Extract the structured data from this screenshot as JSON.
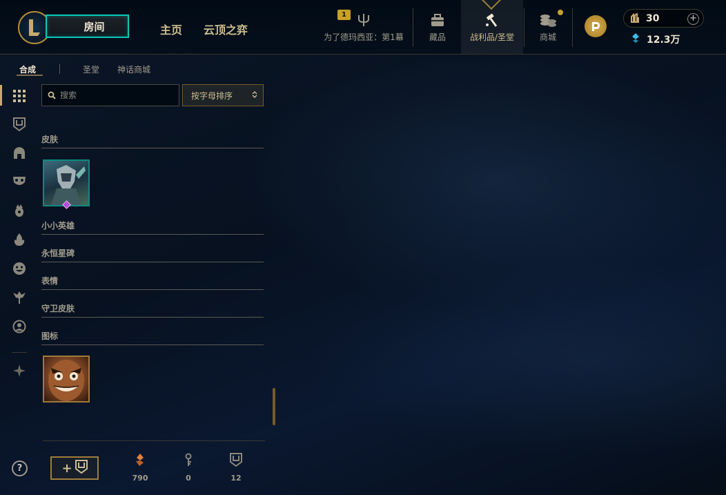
{
  "header": {
    "play_button": "房间",
    "nav_home": "主页",
    "nav_tft": "云顶之弈",
    "mission_badge": "1",
    "mission_label": "为了德玛西亚：第1幕",
    "collection_label": "藏品",
    "loot_label": "战利品/圣堂",
    "store_label": "商城",
    "rp_value": "30",
    "rp_add": "+",
    "be_value": "12.3万"
  },
  "subnav": {
    "craft": "合成",
    "sanctum": "圣堂",
    "mythic_shop": "神话商城"
  },
  "toolbar": {
    "search_placeholder": "搜索",
    "sort_label": "按字母排序"
  },
  "categories": {
    "skins": "皮肤",
    "little_legends": "小小英雄",
    "eternals": "永恒星碑",
    "emotes": "表情",
    "ward_skins": "守卫皮肤",
    "icons": "图标"
  },
  "inventory": {
    "orange_essence": "790",
    "keys": "0",
    "chests": "12"
  },
  "help": "?",
  "rail_icons": [
    "grid-icon",
    "chest-icon",
    "champion-helmet-icon",
    "mask-icon",
    "little-legend-icon",
    "flame-icon",
    "emote-face-icon",
    "ward-icon",
    "profile-icon",
    "mythic-icon"
  ],
  "colors": {
    "gold": "#c8aa6e",
    "teal": "#0ac8b9",
    "background": "#010a13"
  }
}
